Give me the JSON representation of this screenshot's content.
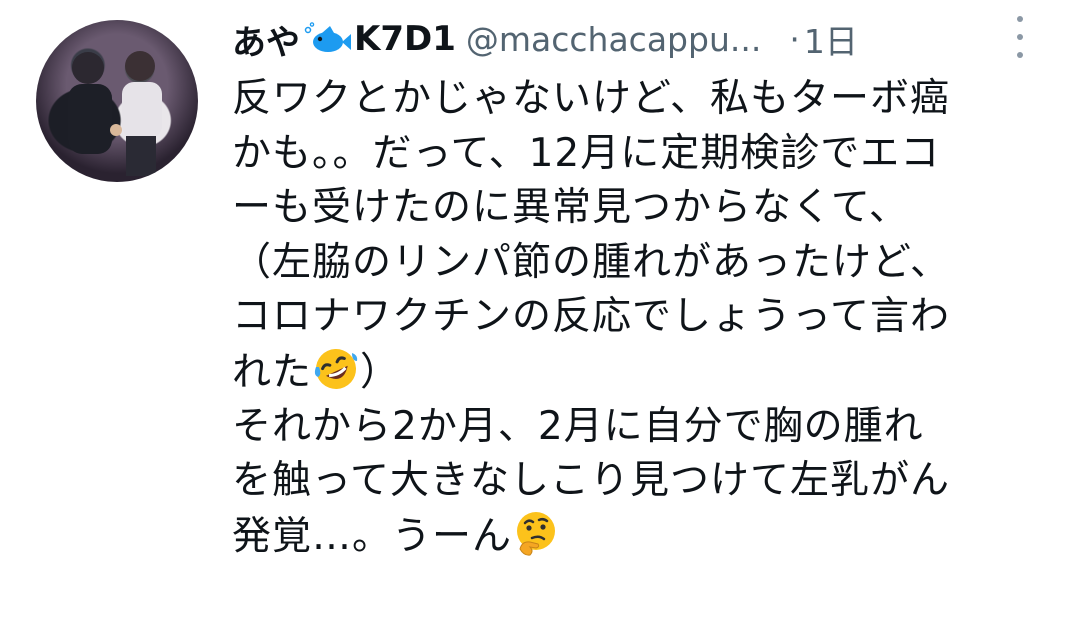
{
  "tweet": {
    "display_name": "あや",
    "display_name_suffix": "K7D1",
    "name_emoji_icon": "fish-icon",
    "handle": "@macchacappu...",
    "separator": "·",
    "time": "1日",
    "more_icon": "more-vertical-icon",
    "avatar_icon": "avatar-photo",
    "lines": [
      "反ワクとかじゃないけど、私もターボ癌",
      "かも。。だって、12月に定期検診でエコ",
      "ーも受けたのに異常見つからなくて、",
      "（左脇のリンパ節の腫れがあったけど、",
      "コロナワクチンの反応でしょうって言わ",
      "れた",
      "それから2か月、2月に自分で胸の腫れ",
      "を触って大きなしこり見つけて左乳がん",
      "発覚…。うーん"
    ],
    "line6_close": "）",
    "emoji_1": "rolling-on-floor-laughing-emoji",
    "emoji_2": "thinking-face-emoji"
  }
}
